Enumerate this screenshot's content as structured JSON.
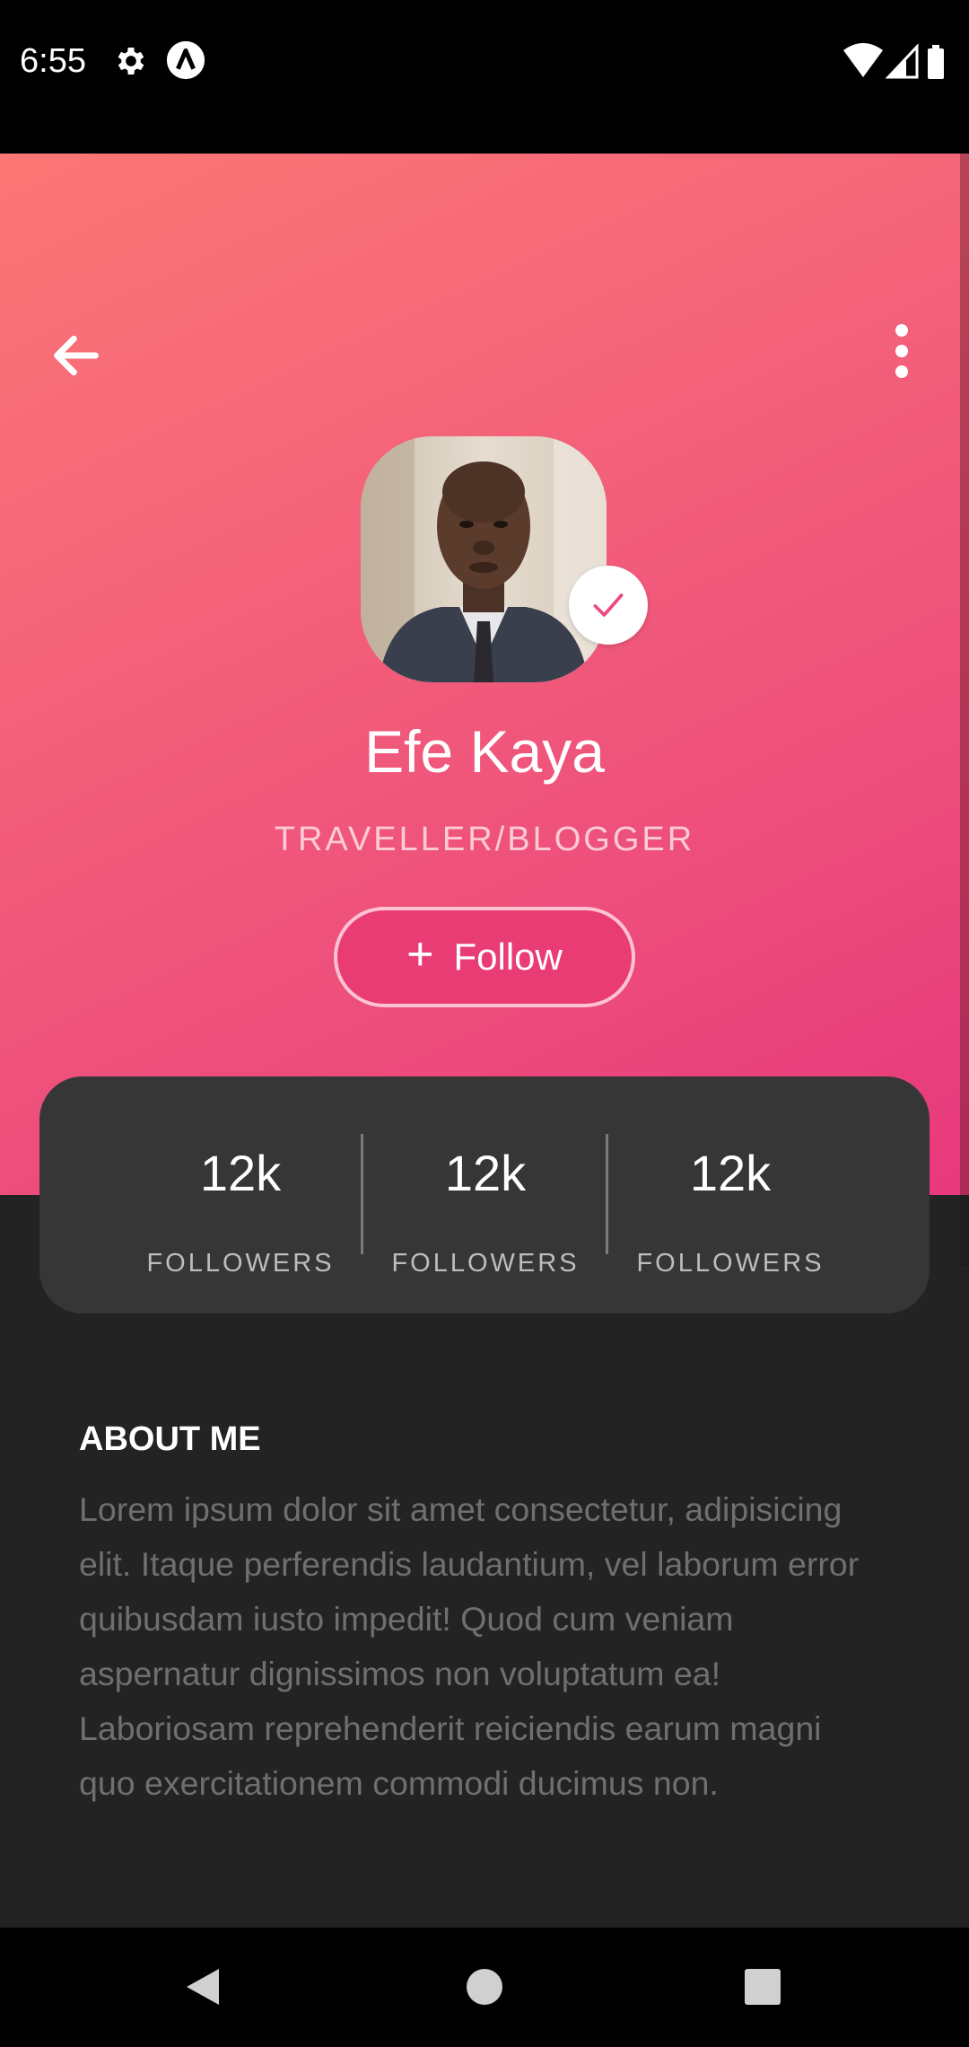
{
  "status_bar": {
    "time": "6:55",
    "icons": [
      "gear-icon",
      "app-a-icon",
      "wifi-icon",
      "signal-icon",
      "battery-icon"
    ]
  },
  "toolbar": {
    "back_icon": "arrow-back-icon",
    "more_icon": "more-vert-icon"
  },
  "profile": {
    "name": "Efe Kaya",
    "role": "TRAVELLER/BLOGGER",
    "verified_icon": "check-icon",
    "follow_label": "Follow",
    "follow_icon": "plus-icon"
  },
  "stats": [
    {
      "value": "12k",
      "label": "FOLLOWERS"
    },
    {
      "value": "12k",
      "label": "FOLLOWERS"
    },
    {
      "value": "12k",
      "label": "FOLLOWERS"
    }
  ],
  "about": {
    "title": "ABOUT ME",
    "text": "Lorem ipsum dolor sit amet consectetur, adipisicing elit. Itaque perferendis laudantium, vel laborum error quibusdam iusto impedit! Quod cum veniam aspernatur dignissimos non voluptatum ea! Laboriosam reprehenderit reiciendis earum magni quo exercitationem commodi ducimus non."
  },
  "nav_bar": {
    "back": "nav-back-icon",
    "home": "nav-home-icon",
    "recents": "nav-recents-icon"
  },
  "colors": {
    "hero_gradient_start": "#fc7775",
    "hero_gradient_end": "#e7387c",
    "accent": "#ea3c74",
    "card_bg": "#363636",
    "page_bg": "#232323"
  }
}
